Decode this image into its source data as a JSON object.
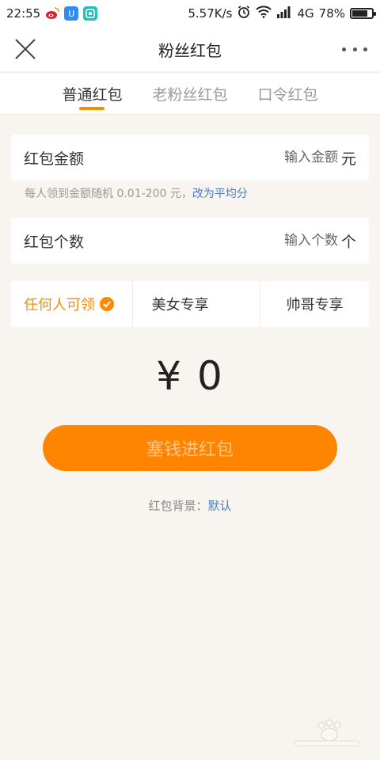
{
  "status_bar": {
    "time": "22:55",
    "net_speed": "5.57K/s",
    "network": "4G",
    "battery": "78%",
    "battery_level": 0.78,
    "app_icons": [
      "weibo-icon",
      "app-u-icon",
      "app-scan-icon"
    ],
    "app_u_glyph": "U"
  },
  "nav": {
    "title": "粉丝红包"
  },
  "tabs": [
    {
      "label": "普通红包",
      "active": true
    },
    {
      "label": "老粉丝红包",
      "active": false
    },
    {
      "label": "口令红包",
      "active": false
    }
  ],
  "amount_field": {
    "label": "红包金额",
    "placeholder": "输入金额",
    "unit": "元"
  },
  "hint": {
    "text": "每人领到金额随机 0.01-200 元，",
    "link": "改为平均分"
  },
  "count_field": {
    "label": "红包个数",
    "placeholder": "输入个数",
    "unit": "个"
  },
  "audience": {
    "options": [
      {
        "label": "任何人可领",
        "selected": true
      },
      {
        "label": "美女专享",
        "selected": false
      },
      {
        "label": "帅哥专享",
        "selected": false
      }
    ]
  },
  "total": {
    "display": "¥ 0"
  },
  "submit": {
    "label": "塞钱进红包"
  },
  "background": {
    "label": "红包背景：",
    "value": "默认"
  },
  "colors": {
    "accent": "#ff8500",
    "link": "#4a7cc0",
    "page_bg": "#f8f5f0"
  }
}
